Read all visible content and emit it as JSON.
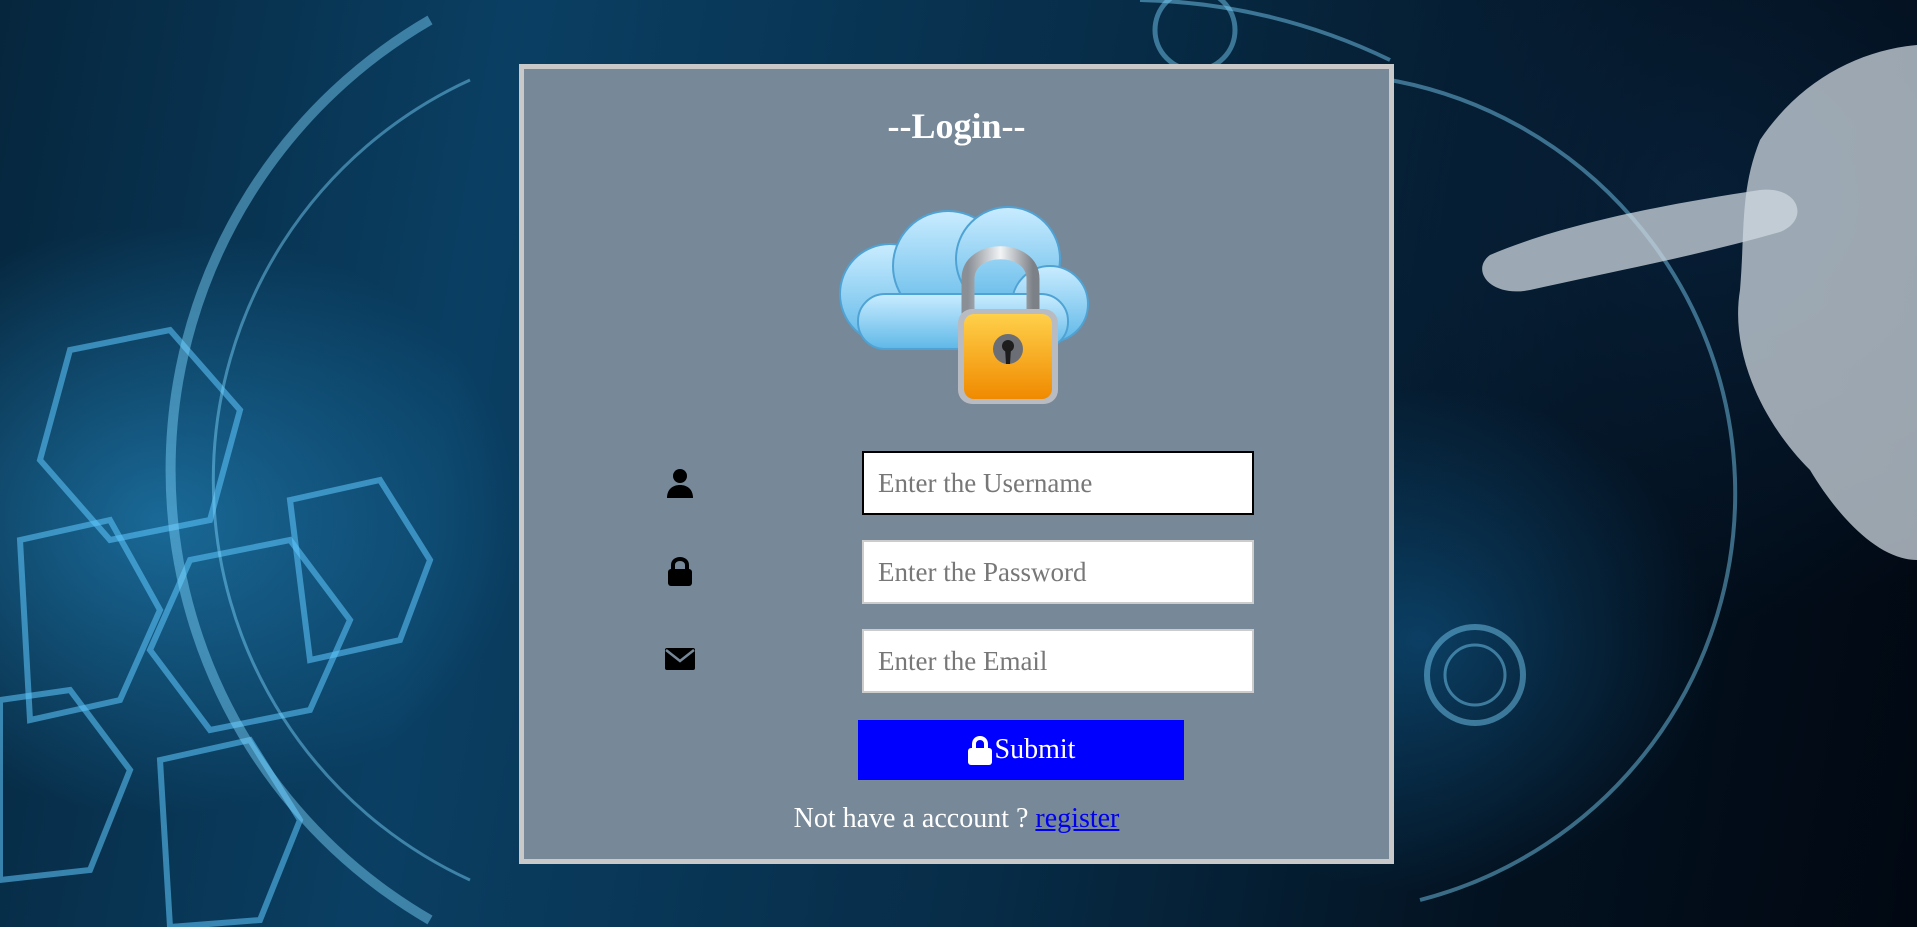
{
  "form": {
    "title": "--Login--",
    "username_placeholder": "Enter the Username",
    "password_placeholder": "Enter the Password",
    "email_placeholder": "Enter the Email",
    "submit_label": "Submit",
    "footer_text": "Not have a account ?",
    "register_link": "register"
  },
  "icons": {
    "username": "user-icon",
    "password": "lock-icon",
    "email": "envelope-icon",
    "submit": "lock-icon",
    "logo": "cloud-padlock-icon"
  },
  "colors": {
    "card_background": "#778899",
    "card_border": "#c9c9c9",
    "submit_button": "#0000ff",
    "link": "#0000ee",
    "title_text": "#ffffff"
  }
}
